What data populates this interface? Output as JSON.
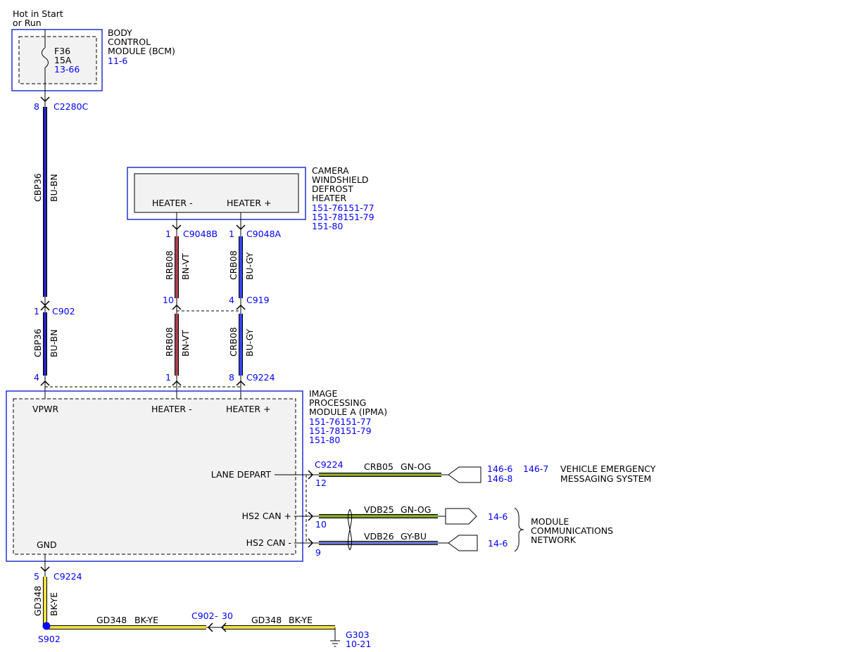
{
  "power_source": {
    "line1": "Hot in Start",
    "line2": "or Run"
  },
  "bcm": {
    "name_lines": [
      "BODY",
      "CONTROL",
      "MODULE (BCM)"
    ],
    "ref": "11-6",
    "fuse": {
      "id": "F36",
      "rating": "15A",
      "ref": "13-66"
    }
  },
  "camera_heater": {
    "name_lines": [
      "CAMERA",
      "WINDSHIELD",
      "DEFROST",
      "HEATER"
    ],
    "refs": [
      "151-76151-77",
      "151-78151-79",
      "151-80"
    ],
    "pins": {
      "neg": "HEATER -",
      "pos": "HEATER +"
    }
  },
  "ipma": {
    "name_lines": [
      "IMAGE",
      "PROCESSING",
      "MODULE A (IPMA)"
    ],
    "refs": [
      "151-76151-77",
      "151-78151-79",
      "151-80"
    ],
    "pins": {
      "vpwr": "VPWR",
      "heater_neg": "HEATER -",
      "heater_pos": "HEATER +",
      "lane_depart": "LANE DEPART",
      "hs2_can_pos": "HS2 CAN +",
      "hs2_can_neg": "HS2 CAN -",
      "gnd": "GND"
    }
  },
  "connectors": {
    "c2280c": {
      "pin": "8",
      "name": "C2280C"
    },
    "c902": {
      "pin": "1",
      "name": "C902"
    },
    "c902_vpwr_pin": "4",
    "c9048b": {
      "pin": "1",
      "name": "C9048B"
    },
    "c9048a": {
      "pin": "1",
      "name": "C9048A"
    },
    "c919": {
      "pin_neg": "10",
      "pin_pos": "4",
      "name": "C919"
    },
    "c9224_top": {
      "pin_neg": "1",
      "pin_pos": "8",
      "name": "C9224"
    },
    "c9224_lane": {
      "name": "C9224",
      "pin": "12"
    },
    "c9224_can": {
      "pin_pos": "10",
      "pin_neg": "9"
    },
    "c9224_gnd": {
      "pin": "5",
      "name": "C9224"
    },
    "c902_gnd": {
      "name": "C902",
      "pin": "30"
    }
  },
  "wires": {
    "cbp36_upper": {
      "circuit": "CBP36",
      "color": "BU-BN"
    },
    "cbp36_lower": {
      "circuit": "CBP36",
      "color": "BU-BN"
    },
    "rrb08_upper": {
      "circuit": "RRB08",
      "color": "BN-VT"
    },
    "rrb08_lower": {
      "circuit": "RRB08",
      "color": "BN-VT"
    },
    "crb08_upper": {
      "circuit": "CRB08",
      "color": "BU-GY"
    },
    "crb08_lower": {
      "circuit": "CRB08",
      "color": "BU-GY"
    },
    "crb05": {
      "circuit": "CRB05",
      "color": "GN-OG"
    },
    "vdb25": {
      "circuit": "VDB25",
      "color": "GN-OG"
    },
    "vdb26": {
      "circuit": "VDB26",
      "color": "GY-BU"
    },
    "gd348_vertical": {
      "circuit": "GD348",
      "color": "BK-YE"
    },
    "gd348_left": {
      "circuit": "GD348",
      "color": "BK-YE"
    },
    "gd348_right": {
      "circuit": "GD348",
      "color": "BK-YE"
    }
  },
  "destinations": {
    "vems": {
      "refs_row1": [
        "146-6",
        "146-7"
      ],
      "ref_row2": "146-8",
      "name_lines": [
        "VEHICLE EMERGENCY",
        "MESSAGING SYSTEM"
      ]
    },
    "mcn": {
      "ref_pos": "14-6",
      "ref_neg": "14-6",
      "name_lines": [
        "MODULE",
        "COMMUNICATIONS",
        "NETWORK"
      ]
    }
  },
  "splice": {
    "name": "S902"
  },
  "ground": {
    "name": "G303",
    "ref": "10-21"
  },
  "colors": {
    "bu_bn": "#2222bb",
    "bn_vt": "#a84050",
    "bu_gy": "#3344ee",
    "gn_og": "#4a9a2a",
    "gy_bu": "#8890a8",
    "bk_ye": "#f0e040",
    "ref_blue": "#0000ff",
    "module_border": "#2233cc",
    "module_fill": "#f2f2f2"
  }
}
